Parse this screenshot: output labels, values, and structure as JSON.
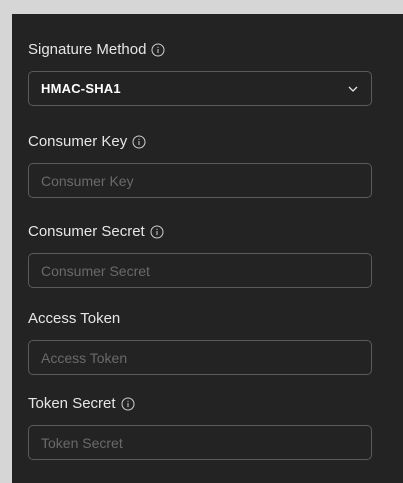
{
  "fields": {
    "signature_method": {
      "label": "Signature Method",
      "value": "HMAC-SHA1",
      "info_icon": "info-icon",
      "dropdown_icon": "chevron-down-icon"
    },
    "consumer_key": {
      "label": "Consumer Key",
      "placeholder": "Consumer Key",
      "value": "",
      "info_icon": "info-icon"
    },
    "consumer_secret": {
      "label": "Consumer Secret",
      "placeholder": "Consumer Secret",
      "value": "",
      "info_icon": "info-icon"
    },
    "access_token": {
      "label": "Access Token",
      "placeholder": "Access Token",
      "value": ""
    },
    "token_secret": {
      "label": "Token Secret",
      "placeholder": "Token Secret",
      "value": "",
      "info_icon": "info-icon"
    }
  },
  "colors": {
    "panel_background": "#232323",
    "outer_background": "#d6d6d6",
    "border": "#5a5a5a",
    "label_text": "#e6e6e6",
    "placeholder_text": "#6a6a6a"
  }
}
